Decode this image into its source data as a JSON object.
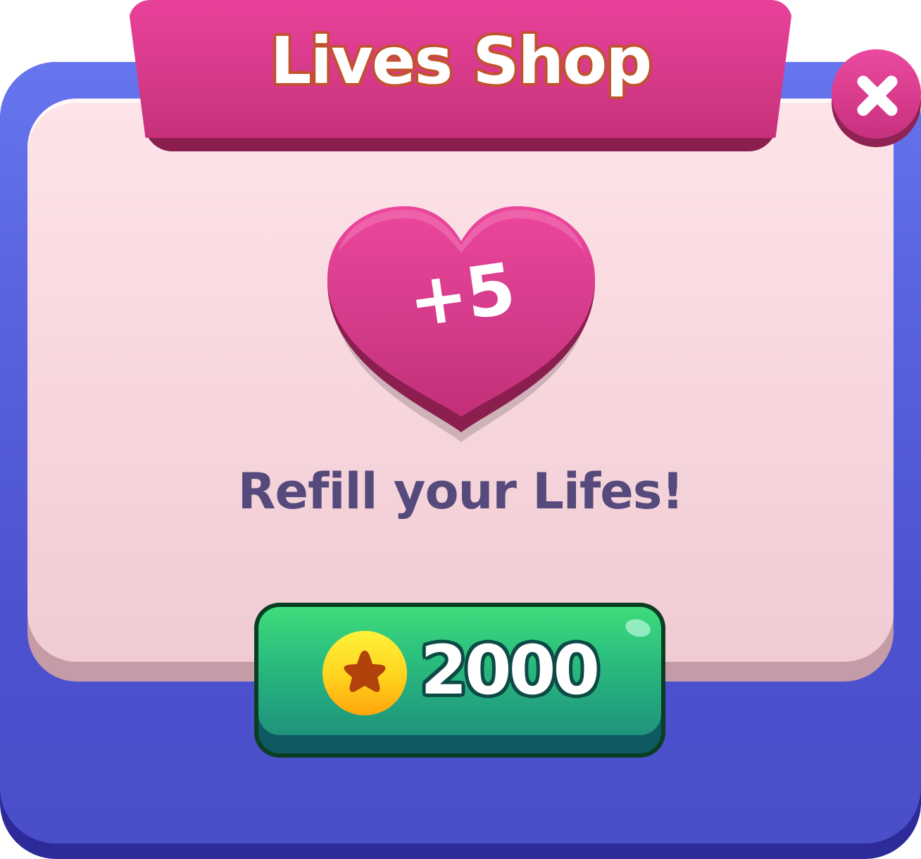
{
  "dialog": {
    "title": "Lives Shop",
    "subtitle": "Refill your Lifes!"
  },
  "reward": {
    "label": "+5",
    "icon": "heart-icon"
  },
  "purchase": {
    "price": "2000",
    "currency_icon": "star-coin-icon"
  },
  "close": {
    "icon": "close-icon"
  },
  "colors": {
    "frame": "#5a63e0",
    "panel": "#fde4e8",
    "banner": "#e8419a",
    "heart": "#e8419a",
    "button": "#2dc27d",
    "subtitle": "#564a7d",
    "coin": "#ffd21e"
  }
}
